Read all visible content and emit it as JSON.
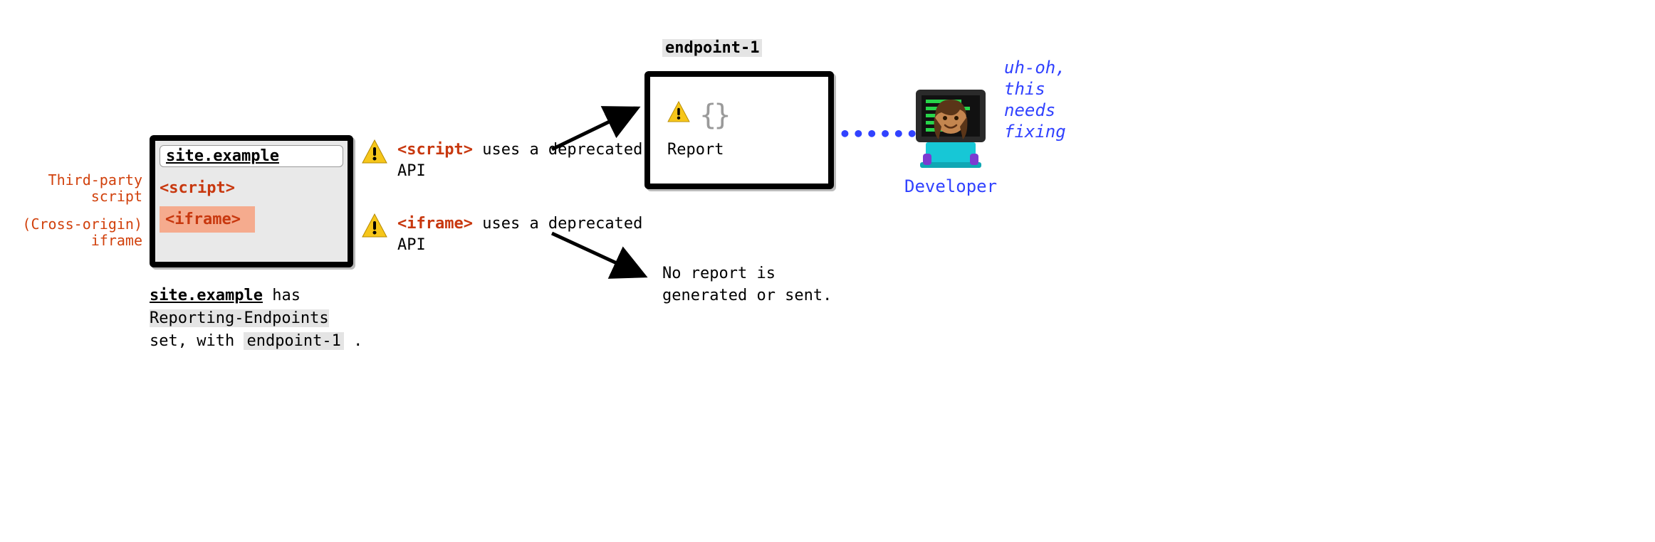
{
  "browser": {
    "url": "site.example",
    "script_tag": "<script>",
    "iframe_tag": "<iframe>"
  },
  "left_labels": {
    "script_l1": "Third-party",
    "script_l2": "script",
    "iframe_l1": "(Cross-origin)",
    "iframe_l2": "iframe"
  },
  "caption": {
    "p1a": "site.example",
    "p1b": " has",
    "p2": "Reporting-Endpoints",
    "p3a": "set, with ",
    "p3b": "endpoint-1",
    "p3c": " ."
  },
  "warnings": {
    "script": {
      "tag": "<script>",
      "rest": " uses a deprecated API"
    },
    "iframe": {
      "tag": "<iframe>",
      "rest": " uses a deprecated API"
    }
  },
  "endpoint": {
    "title": "endpoint-1",
    "braces": "{}",
    "report_label": "Report"
  },
  "no_report": {
    "l1": "No report is",
    "l2": "generated or sent."
  },
  "developer": {
    "label": "Developer",
    "uhoh_l1": "uh-oh,",
    "uhoh_l2": "this",
    "uhoh_l3": "needs",
    "uhoh_l4": "fixing"
  },
  "icons": {
    "warning": "warning",
    "brace": "brace"
  }
}
